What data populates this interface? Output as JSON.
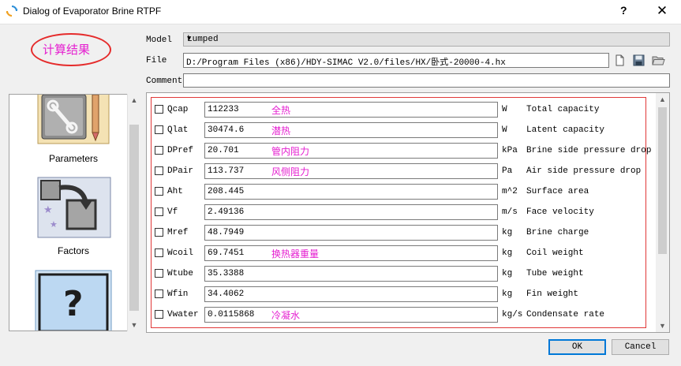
{
  "window": {
    "title": "Dialog of Evaporator Brine RTPF",
    "help_label": "?",
    "close_label": "✕"
  },
  "annotation": {
    "text": "计算结果",
    "color": "#e51fd0",
    "ellipse_color": "#e52b2b"
  },
  "form": {
    "model_label": "Model",
    "model_value": "Lumped",
    "file_label": "File",
    "file_value": "D:/Program Files (x86)/HDY-SIMAC V2.0/files/HX/卧式-20000-4.hx",
    "comment_label": "Comment",
    "comment_value": ""
  },
  "sidebar": {
    "items": [
      {
        "label": "Parameters",
        "icon": "wrench-pencil-icon"
      },
      {
        "label": "Factors",
        "icon": "factors-arrow-icon"
      },
      {
        "label": "",
        "icon": "question-mark-icon"
      }
    ]
  },
  "results": [
    {
      "name": "Qcap",
      "value": "112233",
      "note": "全热",
      "unit": "W",
      "desc": "Total capacity"
    },
    {
      "name": "Qlat",
      "value": "30474.6",
      "note": "潜热",
      "unit": "W",
      "desc": "Latent capacity"
    },
    {
      "name": "DPref",
      "value": "20.701",
      "note": "管内阻力",
      "unit": "kPa",
      "desc": "Brine side pressure drop"
    },
    {
      "name": "DPair",
      "value": "113.737",
      "note": "风侧阻力",
      "unit": "Pa",
      "desc": "Air side pressure drop"
    },
    {
      "name": "Aht",
      "value": "208.445",
      "note": "",
      "unit": "m^2",
      "desc": "Surface area"
    },
    {
      "name": "Vf",
      "value": "2.49136",
      "note": "",
      "unit": "m/s",
      "desc": "Face velocity"
    },
    {
      "name": "Mref",
      "value": "48.7949",
      "note": "",
      "unit": "kg",
      "desc": "Brine charge"
    },
    {
      "name": "Wcoil",
      "value": "69.7451",
      "note": "换热器重量",
      "unit": "kg",
      "desc": "Coil weight"
    },
    {
      "name": "Wtube",
      "value": "35.3388",
      "note": "",
      "unit": "kg",
      "desc": "Tube weight"
    },
    {
      "name": "Wfin",
      "value": "34.4062",
      "note": "",
      "unit": "kg",
      "desc": "Fin weight"
    },
    {
      "name": "Vwater",
      "value": "0.0115868",
      "note": "冷凝水",
      "unit": "kg/s",
      "desc": "Condensate rate"
    }
  ],
  "buttons": {
    "ok": "OK",
    "cancel": "Cancel"
  },
  "colors": {
    "accent": "#0078d7",
    "highlight_box": "#e03838"
  }
}
